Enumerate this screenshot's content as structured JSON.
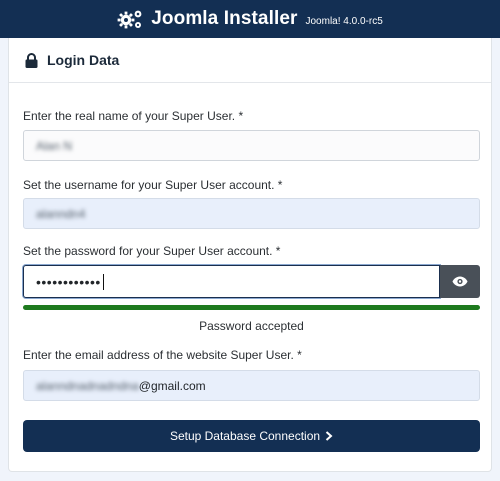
{
  "header": {
    "title": "Joomla Installer",
    "version": "Joomla! 4.0.0-rc5",
    "icon": "cogs-icon"
  },
  "card": {
    "title": "Login Data",
    "icon": "lock-icon"
  },
  "form": {
    "realname": {
      "label": "Enter the real name of your Super User. *",
      "value": "Alan N"
    },
    "username": {
      "label": "Set the username for your Super User account. *",
      "value": "alanndn4"
    },
    "password": {
      "label": "Set the password for your Super User account. *",
      "value": "••••••••••••",
      "toggle_icon": "eye-icon",
      "strength": 1.0,
      "strength_text": "Password accepted",
      "strength_color": "#1e7a1e"
    },
    "email": {
      "label": "Enter the email address of the website Super User. *",
      "local_part": "alanndnadnadndna",
      "domain_part": "@gmail.com"
    }
  },
  "actions": {
    "submit_label": "Setup Database Connection",
    "submit_icon": "chevron-right-icon"
  },
  "colors": {
    "brand": "#132f53",
    "success": "#1e7a1e"
  }
}
